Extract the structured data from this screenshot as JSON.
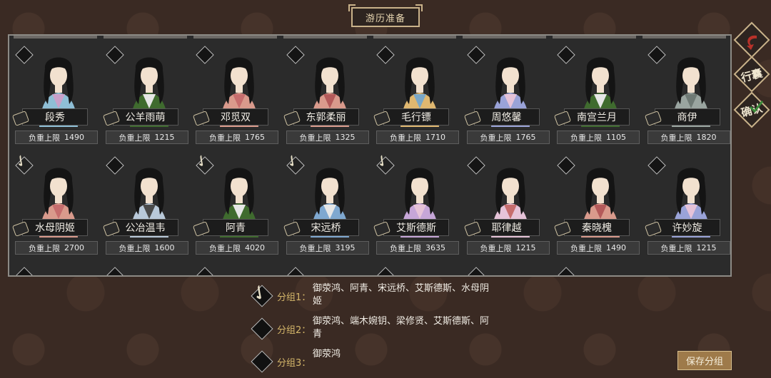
{
  "header": {
    "title": "游历准备"
  },
  "weight_label": "负重上限",
  "characters": [
    {
      "name": "段秀",
      "weight": "1490",
      "checked": false,
      "robe": "#8fbfd6",
      "accent": "#c9a0c9"
    },
    {
      "name": "公羊雨萌",
      "weight": "1215",
      "checked": false,
      "robe": "#3f6b2e",
      "accent": "#e6e6e6"
    },
    {
      "name": "邓觅双",
      "weight": "1765",
      "checked": false,
      "robe": "#d99a8c",
      "accent": "#c66d6d"
    },
    {
      "name": "东郭柔丽",
      "weight": "1325",
      "checked": false,
      "robe": "#d99a8c",
      "accent": "#b45a5a"
    },
    {
      "name": "毛行镖",
      "weight": "1710",
      "checked": false,
      "robe": "#e0b870",
      "accent": "#7aa7c7"
    },
    {
      "name": "周悠馨",
      "weight": "1765",
      "checked": false,
      "robe": "#9aa3d8",
      "accent": "#e6c3d8"
    },
    {
      "name": "南宫兰月",
      "weight": "1105",
      "checked": false,
      "robe": "#3f6b2e",
      "accent": "#e6e6e6"
    },
    {
      "name": "商伊",
      "weight": "1820",
      "checked": false,
      "robe": "#9aa5a0",
      "accent": "#6f7a75"
    },
    {
      "name": "水母阴姬",
      "weight": "2700",
      "checked": true,
      "robe": "#d99a8c",
      "accent": "#c66d6d"
    },
    {
      "name": "公冶温韦",
      "weight": "1600",
      "checked": false,
      "robe": "#b9c9d9",
      "accent": "#4a4a4a"
    },
    {
      "name": "阿青",
      "weight": "4020",
      "checked": true,
      "robe": "#3f6b2e",
      "accent": "#e6e6e6"
    },
    {
      "name": "宋远桥",
      "weight": "3195",
      "checked": true,
      "robe": "#7fa8d0",
      "accent": "#e6e6e6"
    },
    {
      "name": "艾斯德斯",
      "weight": "3635",
      "checked": true,
      "robe": "#c6a6d8",
      "accent": "#e6c3d8"
    },
    {
      "name": "耶律越",
      "weight": "1215",
      "checked": false,
      "robe": "#e6c3d8",
      "accent": "#c66d6d"
    },
    {
      "name": "秦晓槐",
      "weight": "1490",
      "checked": false,
      "robe": "#d99a8c",
      "accent": "#b45a5a"
    },
    {
      "name": "许妙旋",
      "weight": "1215",
      "checked": false,
      "robe": "#9aa3d8",
      "accent": "#e6c3d8"
    }
  ],
  "groups": [
    {
      "label": "分组1：",
      "members": "御荥鸿、阿青、宋远桥、艾斯德斯、水母阴姬",
      "checked": true
    },
    {
      "label": "分组2：",
      "members": "御荥鸿、端木婉钥、梁修贤、艾斯德斯、阿青",
      "checked": false
    },
    {
      "label": "分组3：",
      "members": "御荥鸿",
      "checked": false
    }
  ],
  "side_buttons": [
    {
      "label": "",
      "icon": "return-arrow-icon"
    },
    {
      "label": "行囊",
      "icon": "bag-icon"
    },
    {
      "label": "确认",
      "icon": "confirm-check-icon"
    }
  ],
  "save_button": "保存分组",
  "colors": {
    "accent_gold": "#c9b28a",
    "return_red": "#b8322a"
  }
}
